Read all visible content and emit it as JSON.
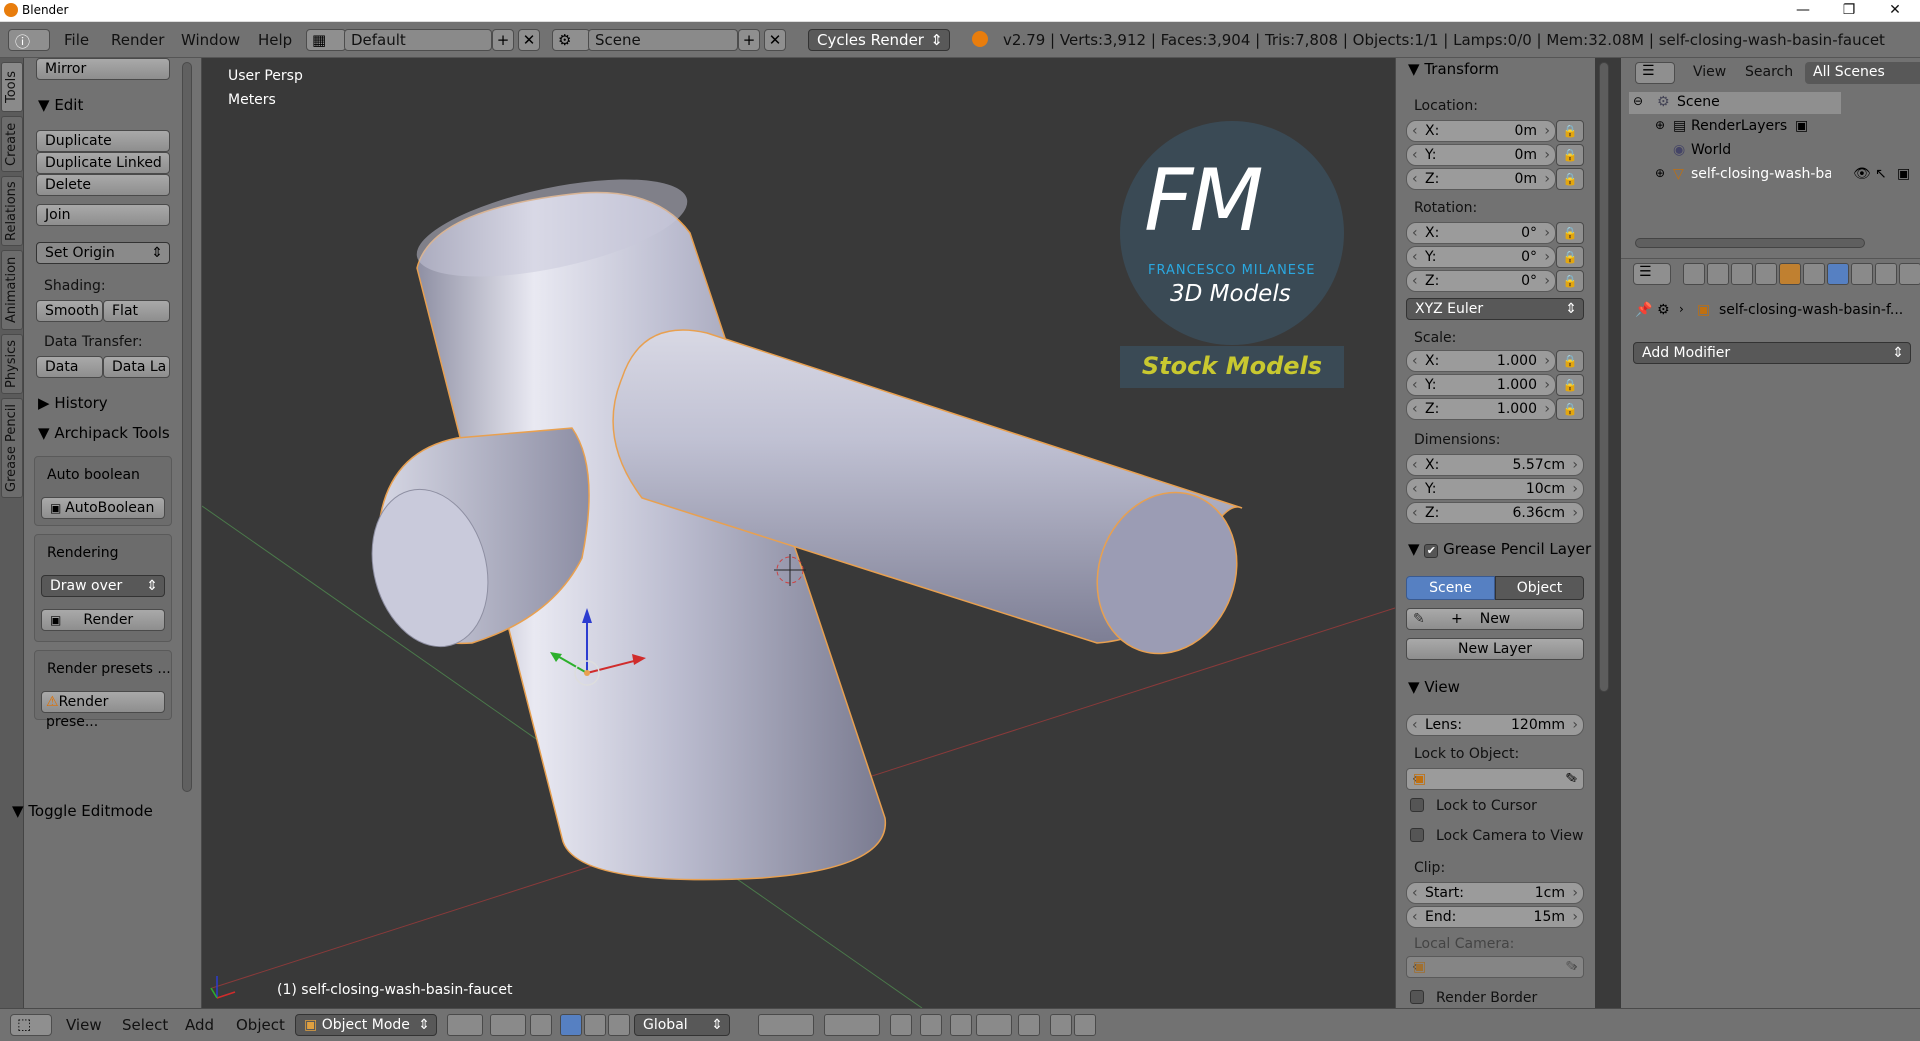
{
  "window": {
    "title": "Blender",
    "controls": [
      "—",
      "❐",
      "✕"
    ]
  },
  "header": {
    "menus": [
      "File",
      "Render",
      "Window",
      "Help"
    ],
    "screen_layout": "Default",
    "scene": "Scene",
    "engine": "Cycles Render",
    "stats": "v2.79 | Verts:3,912 | Faces:3,904 | Tris:7,808 | Objects:1/1 | Lamps:0/0 | Mem:32.08M | self-closing-wash-basin-faucet"
  },
  "left_tabs": [
    "Tools",
    "Create",
    "Relations",
    "Animation",
    "Physics",
    "Grease Pencil"
  ],
  "toolshelf": {
    "mirror": "Mirror",
    "edit_header": "Edit",
    "duplicate": "Duplicate",
    "duplicate_linked": "Duplicate Linked",
    "delete": "Delete",
    "join": "Join",
    "set_origin": "Set Origin",
    "shading_label": "Shading:",
    "smooth": "Smooth",
    "flat": "Flat",
    "data_transfer_label": "Data Transfer:",
    "data": "Data",
    "data_la": "Data La",
    "history": "History",
    "archipack": "Archipack Tools",
    "auto_boolean_label": "Auto boolean",
    "autoboolean_btn": "AutoBoolean",
    "rendering_label": "Rendering",
    "draw_over": "Draw over",
    "render_btn": "Render",
    "render_presets_label": "Render presets ...",
    "render_presets_btn": "Render prese...",
    "toggle_editmode": "Toggle Editmode"
  },
  "viewport": {
    "persp": "User Persp",
    "units": "Meters",
    "object_label": "(1) self-closing-wash-basin-faucet",
    "logo": {
      "letters": "FM",
      "name": "FRANCESCO MILANESE",
      "sub": "3D Models",
      "badge": "Stock Models"
    }
  },
  "npanel": {
    "transform": "Transform",
    "location": "Location:",
    "loc": [
      {
        "k": "X:",
        "v": "0m"
      },
      {
        "k": "Y:",
        "v": "0m"
      },
      {
        "k": "Z:",
        "v": "0m"
      }
    ],
    "rotation": "Rotation:",
    "rot": [
      {
        "k": "X:",
        "v": "0°"
      },
      {
        "k": "Y:",
        "v": "0°"
      },
      {
        "k": "Z:",
        "v": "0°"
      }
    ],
    "euler": "XYZ Euler",
    "scale": "Scale:",
    "scl": [
      {
        "k": "X:",
        "v": "1.000"
      },
      {
        "k": "Y:",
        "v": "1.000"
      },
      {
        "k": "Z:",
        "v": "1.000"
      }
    ],
    "dimensions": "Dimensions:",
    "dim": [
      {
        "k": "X:",
        "v": "5.57cm"
      },
      {
        "k": "Y:",
        "v": "10cm"
      },
      {
        "k": "Z:",
        "v": "6.36cm"
      }
    ],
    "grease_pencil_layer": "Grease Pencil Layer",
    "scene_tab": "Scene",
    "object_tab": "Object",
    "new": "New",
    "new_layer": "New Layer",
    "view": "View",
    "lens_k": "Lens:",
    "lens_v": "120mm",
    "lock_to_object": "Lock to Object:",
    "lock_to_cursor": "Lock to Cursor",
    "lock_camera": "Lock Camera to View",
    "clip": "Clip:",
    "clip_start_k": "Start:",
    "clip_start_v": "1cm",
    "clip_end_k": "End:",
    "clip_end_v": "15m",
    "local_camera": "Local Camera:",
    "render_border": "Render Border"
  },
  "outliner": {
    "view": "View",
    "search": "Search",
    "filter": "All Scenes",
    "items": [
      "Scene",
      "RenderLayers",
      "World",
      "self-closing-wash-basin"
    ]
  },
  "properties": {
    "object_name": "self-closing-wash-basin-f...",
    "add_modifier": "Add Modifier"
  },
  "bottom": {
    "menus": [
      "View",
      "Select",
      "Add",
      "Object"
    ],
    "mode": "Object Mode",
    "orientation": "Global"
  },
  "colors": {
    "accent": "#5680c2",
    "selection_outline": "#e8a050",
    "brand": "#2aa8e0",
    "badge_text": "#c8c830"
  }
}
